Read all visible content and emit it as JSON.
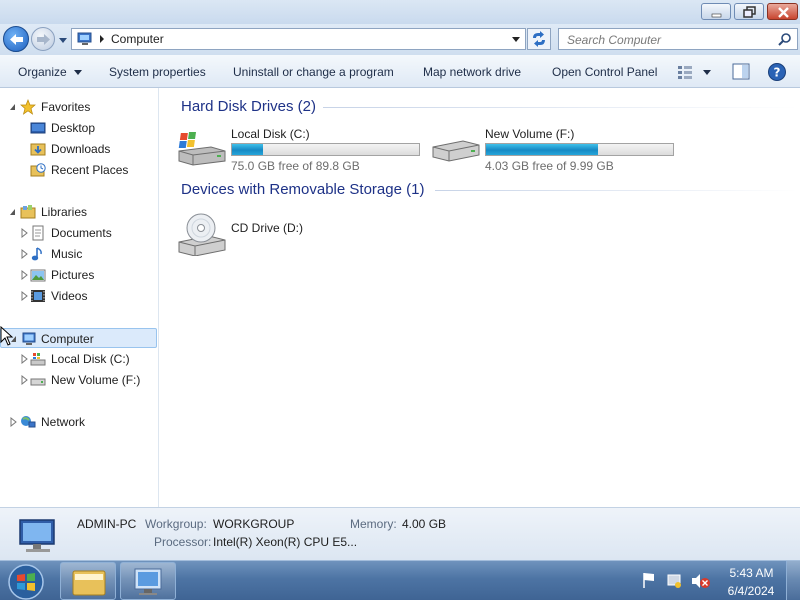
{
  "navigation": {
    "address": "Computer",
    "search_placeholder": "Search Computer"
  },
  "command_bar": {
    "organize": "Organize",
    "system_properties": "System properties",
    "uninstall": "Uninstall or change a program",
    "map_network_drive": "Map network drive",
    "open_control_panel": "Open Control Panel"
  },
  "nav_pane": {
    "favorites": {
      "label": "Favorites",
      "items": [
        {
          "label": "Desktop"
        },
        {
          "label": "Downloads"
        },
        {
          "label": "Recent Places"
        }
      ]
    },
    "libraries": {
      "label": "Libraries",
      "items": [
        {
          "label": "Documents"
        },
        {
          "label": "Music"
        },
        {
          "label": "Pictures"
        },
        {
          "label": "Videos"
        }
      ]
    },
    "computer": {
      "label": "Computer",
      "items": [
        {
          "label": "Local Disk (C:)"
        },
        {
          "label": "New Volume (F:)"
        }
      ]
    },
    "network": {
      "label": "Network"
    }
  },
  "content": {
    "groups": [
      {
        "header": "Hard Disk Drives (2)",
        "drives": [
          {
            "name": "Local Disk (C:)",
            "free_text": "75.0 GB free of 89.8 GB",
            "used_fraction": 0.165
          },
          {
            "name": "New Volume (F:)",
            "free_text": "4.03 GB free of 9.99 GB",
            "used_fraction": 0.597
          }
        ]
      },
      {
        "header": "Devices with Removable Storage (1)",
        "drives": [
          {
            "name": "CD Drive (D:)"
          }
        ]
      }
    ]
  },
  "details": {
    "computer_name": "ADMIN-PC",
    "workgroup_label": "Workgroup:",
    "workgroup_value": "WORKGROUP",
    "memory_label": "Memory:",
    "memory_value": "4.00 GB",
    "processor_label": "Processor:",
    "processor_value": "Intel(R) Xeon(R) CPU E5..."
  },
  "taskbar": {
    "time": "5:43 AM",
    "date": "6/4/2024"
  },
  "colors": {
    "accent": "#1e3287",
    "selection": "#dbeafb",
    "bar_fill": "#26a6da"
  }
}
